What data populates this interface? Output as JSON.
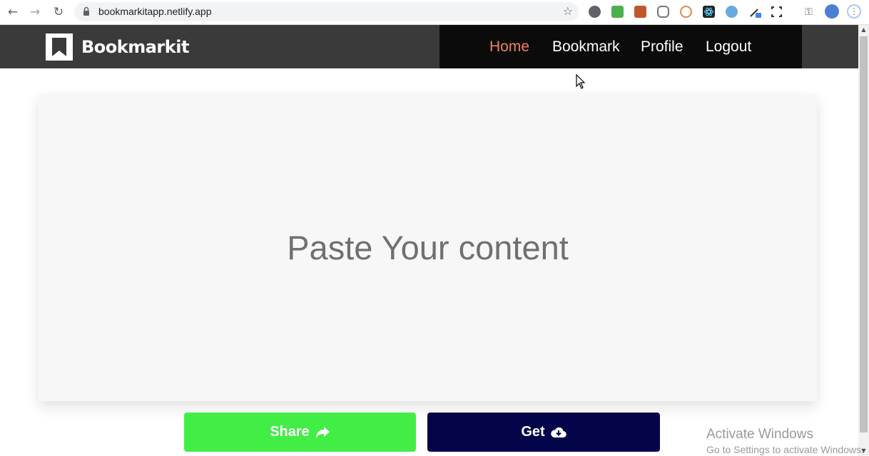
{
  "browser": {
    "url": "bookmarkitapp.netlify.app",
    "icons": [
      "back-icon",
      "forward-icon",
      "reload-icon",
      "lock-icon",
      "star-icon",
      "key-icon",
      "profile-icon",
      "menu-icon"
    ],
    "extensions": [
      "dark-reader-icon",
      "cors-icon",
      "book-icon",
      "extension-icon",
      "swirl-icon",
      "react-devtools-icon",
      "feather-icon",
      "eyedropper-icon",
      "screenshot-icon"
    ]
  },
  "header": {
    "brand": "Bookmarkit",
    "nav": [
      {
        "label": "Home",
        "active": true
      },
      {
        "label": "Bookmark",
        "active": false
      },
      {
        "label": "Profile",
        "active": false
      },
      {
        "label": "Logout",
        "active": false
      }
    ]
  },
  "main": {
    "placeholder": "Paste Your content"
  },
  "actions": {
    "share_label": "Share",
    "get_label": "Get"
  },
  "watermark": {
    "title": "Activate Windows",
    "subtitle": "Go to Settings to activate Windows."
  },
  "colors": {
    "header_bg": "#3a3a3a",
    "nav_bg": "#0b0b0b",
    "active_link": "#f0825c",
    "share": "#42ee46",
    "get": "#04044b",
    "card": "#f7f7f7"
  }
}
